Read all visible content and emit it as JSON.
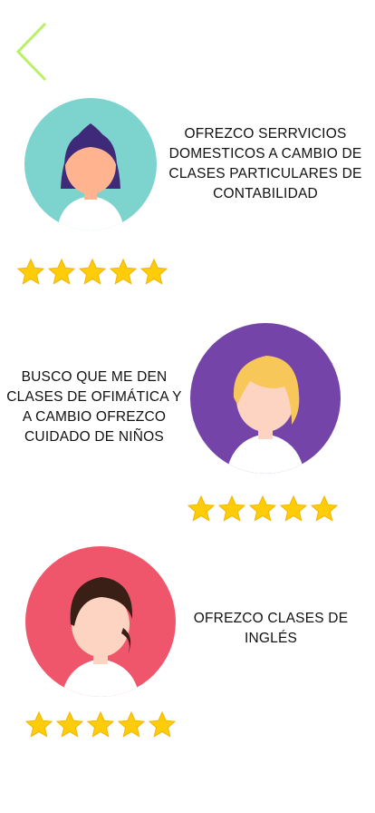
{
  "colors": {
    "accent": "#b8f066",
    "star": "#ffcc0a",
    "star_edge": "#f2b400"
  },
  "header": {
    "back_icon": "chevron-left-icon"
  },
  "offers": [
    {
      "text": "OFREZCO SERRVICIOS DOMESTICOS A CAMBIO DE CLASES PARTICULARES DE CONTABILIDAD",
      "avatar_bg": "#7dd3cd",
      "hair": "#3f2a7a",
      "rating": 5
    },
    {
      "text": "BUSCO QUE ME DEN CLASES DE OFIMÁTICA Y A CAMBIO OFREZCO CUIDADO DE NIÑOS",
      "avatar_bg": "#7444a8",
      "hair": "#f8c75a",
      "rating": 5
    },
    {
      "text": "OFREZCO CLASES DE INGLÉS",
      "avatar_bg": "#f0566b",
      "hair": "#3a1f17",
      "rating": 5
    }
  ]
}
